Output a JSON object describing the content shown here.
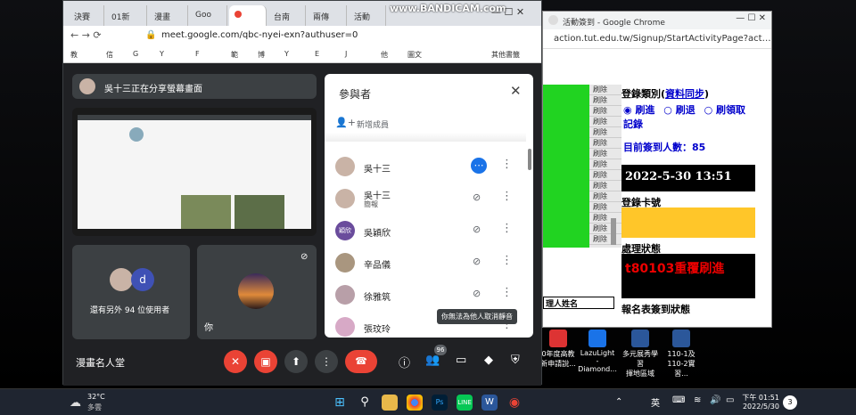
{
  "overlay": {
    "watermark": "www.BANDICAM.com"
  },
  "meet_window": {
    "tabs": [
      "決賽",
      "01新",
      "漫畫",
      "Goo",
      "",
      "台南",
      "兩傳",
      "活動"
    ],
    "url": "meet.google.com/qbc-nyei-exn?authuser=0",
    "bookmarks": [
      "教",
      "信",
      "G",
      "Y",
      "F",
      "範",
      "博",
      "Y",
      "E",
      "J",
      "他",
      "圖文"
    ],
    "bookmarks_other": "其他書籤",
    "presenting_banner": "吳十三正在分享螢幕畫面",
    "tile_more_users": "還有另外 94 位使用者",
    "tile_more_avatar_letter": "d",
    "tile_you": "你",
    "meeting_title": "漫畫名人堂",
    "participant_count_badge": "96"
  },
  "participants_panel": {
    "title": "參與者",
    "add_people": "新增成員",
    "rows": [
      {
        "name": "吳十三",
        "sub": ""
      },
      {
        "name": "吳十三",
        "sub": "簡報"
      },
      {
        "name": "吳穎欣",
        "sub": "",
        "avatar_letters": "穎欣"
      },
      {
        "name": "辛品儀",
        "sub": ""
      },
      {
        "name": "徐雅筑",
        "sub": ""
      },
      {
        "name": "張玟玲",
        "sub": ""
      }
    ],
    "tooltip": "你無法為他人取消靜音"
  },
  "right_window": {
    "title": "活動簽到 - Google Chrome",
    "url": "action.tut.edu.tw/Signup/StartActivityPage?activity...",
    "cells": [
      "刷除",
      "刷除",
      "刷除",
      "刷除",
      "刷除",
      "刷除",
      "刷除",
      "刷除",
      "刷除",
      "刷除",
      "刷除",
      "刷除",
      "刷除",
      "刷除",
      "刷除"
    ],
    "reg_type_label": "登錄類別(",
    "reg_type_link": "資料同步",
    "reg_type_close": ")",
    "radio_in": "刷進",
    "radio_out": "刷退",
    "radio_get": "刷領取",
    "record_label": "記錄",
    "checked_in_count": "目前簽到人數：85",
    "datetime": "2022-5-30 13:51",
    "card_label": "登錄卡號",
    "status_label": "處理狀態",
    "status_msg": "t80103重覆刷進",
    "name_label": "理人姓名",
    "report_label": "報名表簽到狀態"
  },
  "desktop_icons": [
    {
      "label": "0年度高教\n新申請說..."
    },
    {
      "label": "LazuLight -\nDiamond..."
    },
    {
      "label": "多元展秀學習\n揮地區域"
    },
    {
      "label": "110-1及\n110-2實習..."
    }
  ],
  "taskbar": {
    "weather_temp": "32°C",
    "weather_desc": "多雲",
    "ime": "英",
    "time": "下午 01:51",
    "date": "2022/5/30",
    "notif": "3"
  },
  "colors": {
    "meet_bg": "#202124",
    "accent_red": "#ea4335",
    "green": "#21d321",
    "yellow": "#ffc629"
  }
}
